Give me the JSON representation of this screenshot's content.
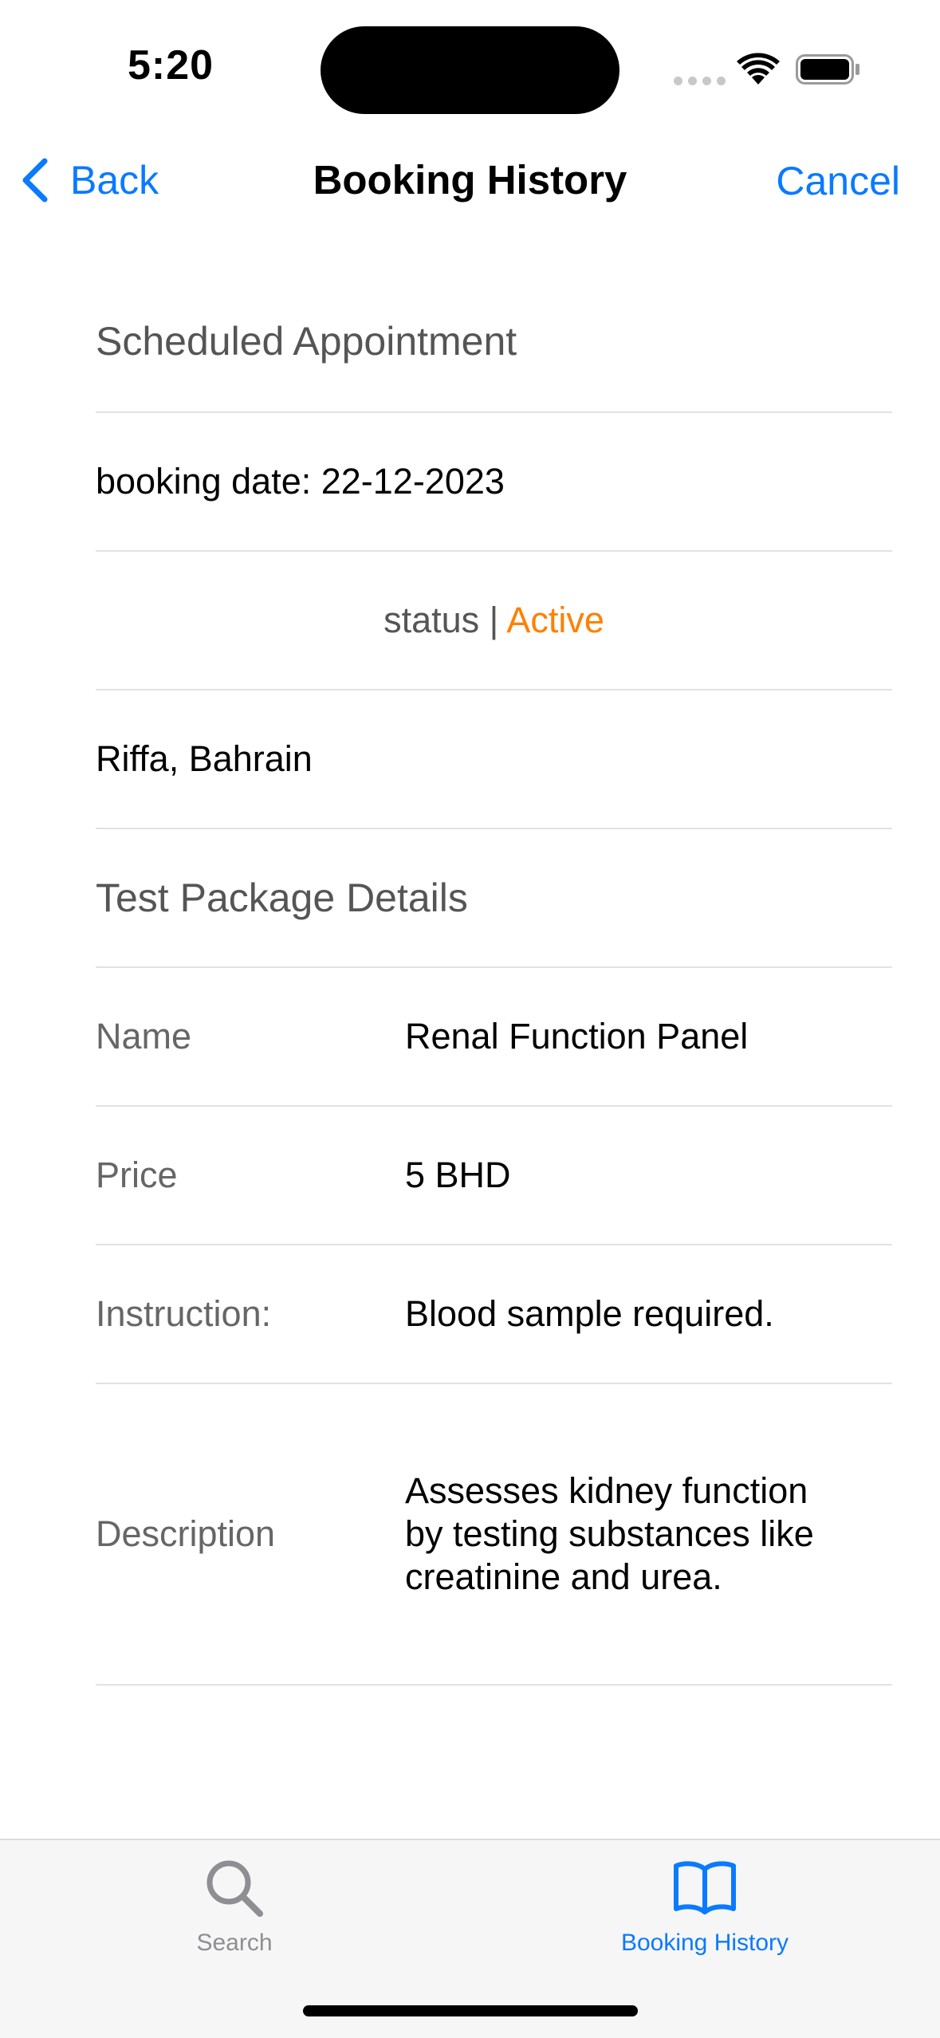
{
  "status_bar": {
    "time": "5:20"
  },
  "nav": {
    "back_label": "Back",
    "title": "Booking History",
    "cancel_label": "Cancel"
  },
  "appointment": {
    "section_title": "Scheduled Appointment",
    "booking_date": "booking date: 22-12-2023",
    "status_prefix": "status | ",
    "status_value": "Active",
    "location": "Riffa, Bahrain"
  },
  "package": {
    "section_title": "Test Package Details",
    "name_label": "Name",
    "name_value": "Renal Function Panel",
    "price_label": "Price",
    "price_value": "5 BHD",
    "instruction_label": "Instruction:",
    "instruction_value": "Blood sample required.",
    "description_label": "Description",
    "description_value": "Assesses kidney function by testing substances like creatinine and urea."
  },
  "tab_bar": {
    "tabs": [
      {
        "label": "Search",
        "icon": "magnifying-glass-icon",
        "selected": false
      },
      {
        "label": "Booking History",
        "icon": "book-icon",
        "selected": true
      }
    ]
  },
  "colors": {
    "accent": "#0a7aff",
    "status_active": "#ff8000",
    "secondary_text": "#555555",
    "separator": "#e2e2e2"
  }
}
